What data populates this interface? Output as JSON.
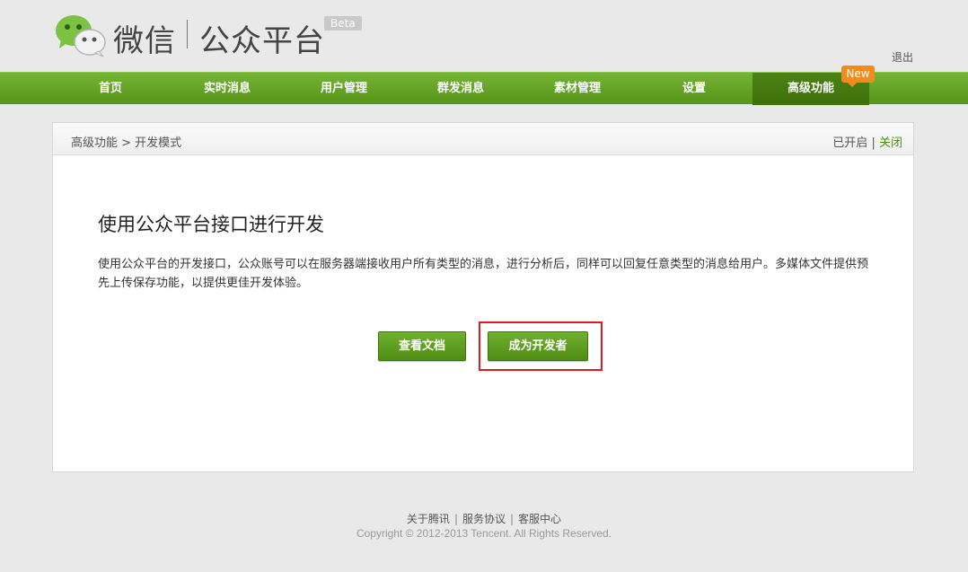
{
  "header": {
    "logo_text_wechat": "微信",
    "logo_text_platform": "公众平台",
    "beta_label": "Beta",
    "logout_label": "退出"
  },
  "nav": {
    "items": [
      {
        "label": "首页"
      },
      {
        "label": "实时消息"
      },
      {
        "label": "用户管理"
      },
      {
        "label": "群发消息"
      },
      {
        "label": "素材管理"
      },
      {
        "label": "设置"
      },
      {
        "label": "高级功能"
      }
    ],
    "active_index": 6,
    "new_badge": "New"
  },
  "panel": {
    "breadcrumb": "高级功能 > 开发模式",
    "status_on": "已开启",
    "status_sep": "|",
    "status_close": "关闭",
    "title": "使用公众平台接口进行开发",
    "description": "使用公众平台的开发接口，公众账号可以在服务器端接收用户所有类型的消息，进行分析后，同样可以回复任意类型的消息给用户。多媒体文件提供预先上传保存功能，以提供更佳开发体验。",
    "btn_docs": "查看文档",
    "btn_developer": "成为开发者"
  },
  "footer": {
    "links": [
      "关于腾讯",
      "服务协议",
      "客服中心"
    ],
    "copyright": "Copyright © 2012-2013 Tencent. All Rights Reserved."
  },
  "colors": {
    "nav_green": "#5fa022",
    "button_green": "#5c9e1c",
    "badge_orange": "#f08c1e",
    "highlight_red": "#d81e1e"
  }
}
